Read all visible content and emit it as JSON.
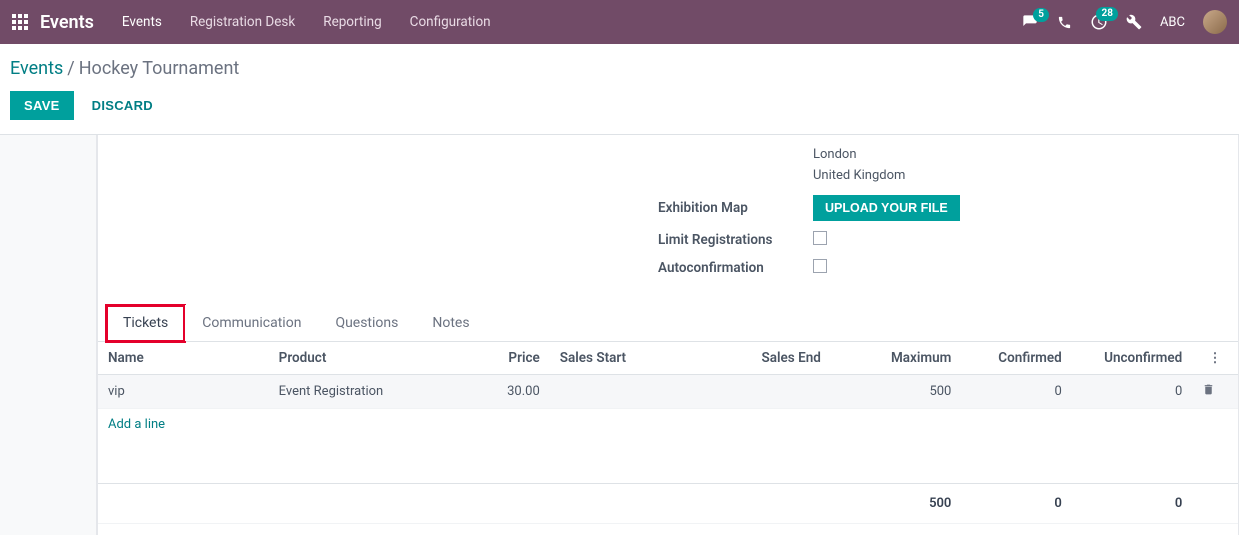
{
  "topbar": {
    "brand": "Events",
    "nav": [
      "Events",
      "Registration Desk",
      "Reporting",
      "Configuration"
    ],
    "messages_badge": "5",
    "activities_badge": "28",
    "user_initials": "ABC"
  },
  "breadcrumb": {
    "root": "Events",
    "current": "Hockey Tournament"
  },
  "actions": {
    "save": "SAVE",
    "discard": "DISCARD"
  },
  "form": {
    "address_city": "London",
    "address_country": "United Kingdom",
    "exhibition_map_label": "Exhibition Map",
    "upload_btn": "UPLOAD YOUR FILE",
    "limit_label": "Limit Registrations",
    "autoconfirm_label": "Autoconfirmation"
  },
  "tabs": [
    "Tickets",
    "Communication",
    "Questions",
    "Notes"
  ],
  "tickets": {
    "columns": {
      "name": "Name",
      "product": "Product",
      "price": "Price",
      "sales_start": "Sales Start",
      "sales_end": "Sales End",
      "maximum": "Maximum",
      "confirmed": "Confirmed",
      "unconfirmed": "Unconfirmed"
    },
    "rows": [
      {
        "name": "vip",
        "product": "Event Registration",
        "price": "30.00",
        "sales_start": "",
        "sales_end": "",
        "maximum": "500",
        "confirmed": "0",
        "unconfirmed": "0"
      }
    ],
    "add_line": "Add a line",
    "totals": {
      "maximum": "500",
      "confirmed": "0",
      "unconfirmed": "0"
    }
  }
}
